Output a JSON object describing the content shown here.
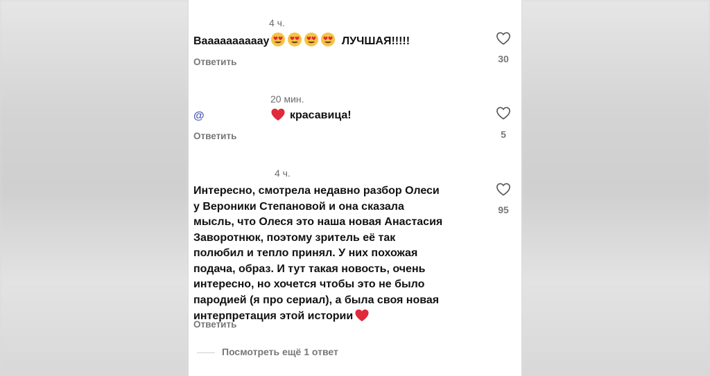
{
  "comments": [
    {
      "time": "4 ч.",
      "text": "Ваааааааааау",
      "suffix": "ЛУЧШАЯ!!!!!",
      "emojis": [
        "heart-eyes",
        "heart-eyes",
        "heart-eyes",
        "heart-eyes"
      ],
      "reply_label": "Ответить",
      "likes": "30"
    },
    {
      "time": "20 мин.",
      "mention": "@",
      "text": "красавица!",
      "emojis": [
        "red-heart"
      ],
      "reply_label": "Ответить",
      "likes": "5"
    },
    {
      "time": "4 ч.",
      "lines": [
        "Интересно, смотрела недавно разбор Олеси",
        "у Вероники Степановой и она сказала",
        "мысль, что Олеся это наша новая Анастасия",
        "Заворотнюк, поэтому зритель её так",
        "полюбил и тепло принял. У них похожая",
        "подача, образ. И тут такая новость, очень",
        "интересно, но хочется чтобы это не было",
        "пародией (я про сериал), а была своя новая",
        "интерпретация этой истории"
      ],
      "emojis": [
        "red-heart"
      ],
      "reply_label": "Ответить",
      "likes": "95"
    }
  ],
  "view_more_label": "Посмотреть ещё 1 ответ",
  "colors": {
    "panel": "#ffffff",
    "text": "#111111",
    "muted": "#777777",
    "mention": "#4a5cb0",
    "heart_red": "#e0293a",
    "emoji_yellow": "#f6c343"
  }
}
